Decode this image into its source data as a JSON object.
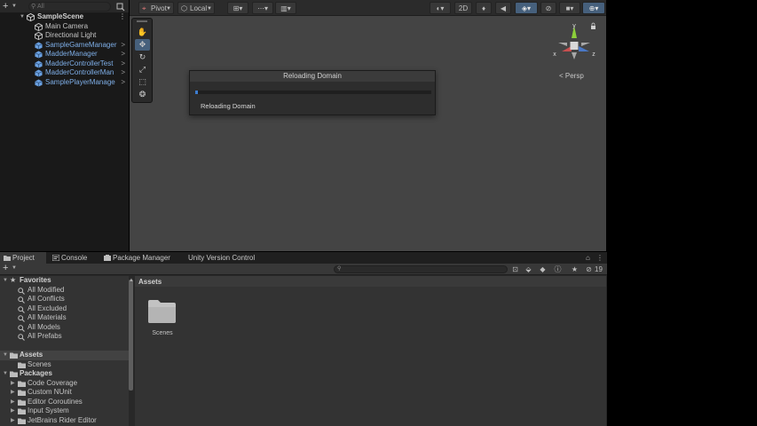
{
  "hierarchy": {
    "add_label": "+",
    "search_placeholder": "All",
    "scene_name": "SampleScene",
    "items": [
      {
        "label": "Main Camera",
        "prefab": false,
        "expandable": false
      },
      {
        "label": "Directional Light",
        "prefab": false,
        "expandable": false
      },
      {
        "label": "SampleGameManager",
        "prefab": true,
        "expandable": true
      },
      {
        "label": "MadderManager",
        "prefab": true,
        "expandable": true
      },
      {
        "label": "MadderControllerTest",
        "prefab": true,
        "expandable": true
      },
      {
        "label": "MadderControllerMan",
        "prefab": true,
        "expandable": true
      },
      {
        "label": "SamplePlayerManage",
        "prefab": true,
        "expandable": true
      }
    ]
  },
  "scene_toolbar": {
    "pivot_label": "Pivot",
    "local_label": "Local",
    "mode_2d_label": "2D",
    "active_tool": "move"
  },
  "gizmo": {
    "x_label": "x",
    "y_label": "y",
    "z_label": "z",
    "projection_label": "< Persp"
  },
  "dialog": {
    "title": "Reloading Domain",
    "status": "Reloading Domain",
    "progress": 0.01
  },
  "bottom_tabs": [
    {
      "label": "Project",
      "active": true
    },
    {
      "label": "Console",
      "active": false
    },
    {
      "label": "Package Manager",
      "active": false
    },
    {
      "label": "Unity Version Control",
      "active": false
    }
  ],
  "project_toolbar": {
    "add_label": "+",
    "hidden_count": "19"
  },
  "tree": {
    "favorites_label": "Favorites",
    "favorites": [
      "All Modified",
      "All Conflicts",
      "All Excluded",
      "All Materials",
      "All Models",
      "All Prefabs"
    ],
    "assets_label": "Assets",
    "assets_children": [
      "Scenes"
    ],
    "packages_label": "Packages",
    "packages": [
      "Code Coverage",
      "Custom NUnit",
      "Editor Coroutines",
      "Input System",
      "JetBrains Rider Editor"
    ]
  },
  "assets_view": {
    "title": "Assets",
    "folders": [
      "Scenes"
    ]
  },
  "colors": {
    "accent": "#46607c",
    "prefab_text": "#7eaee7",
    "progress": "#3c7ccf",
    "gizmo_x": "#c94f4f",
    "gizmo_y": "#8ccf3a",
    "gizmo_z": "#4a78c6"
  }
}
